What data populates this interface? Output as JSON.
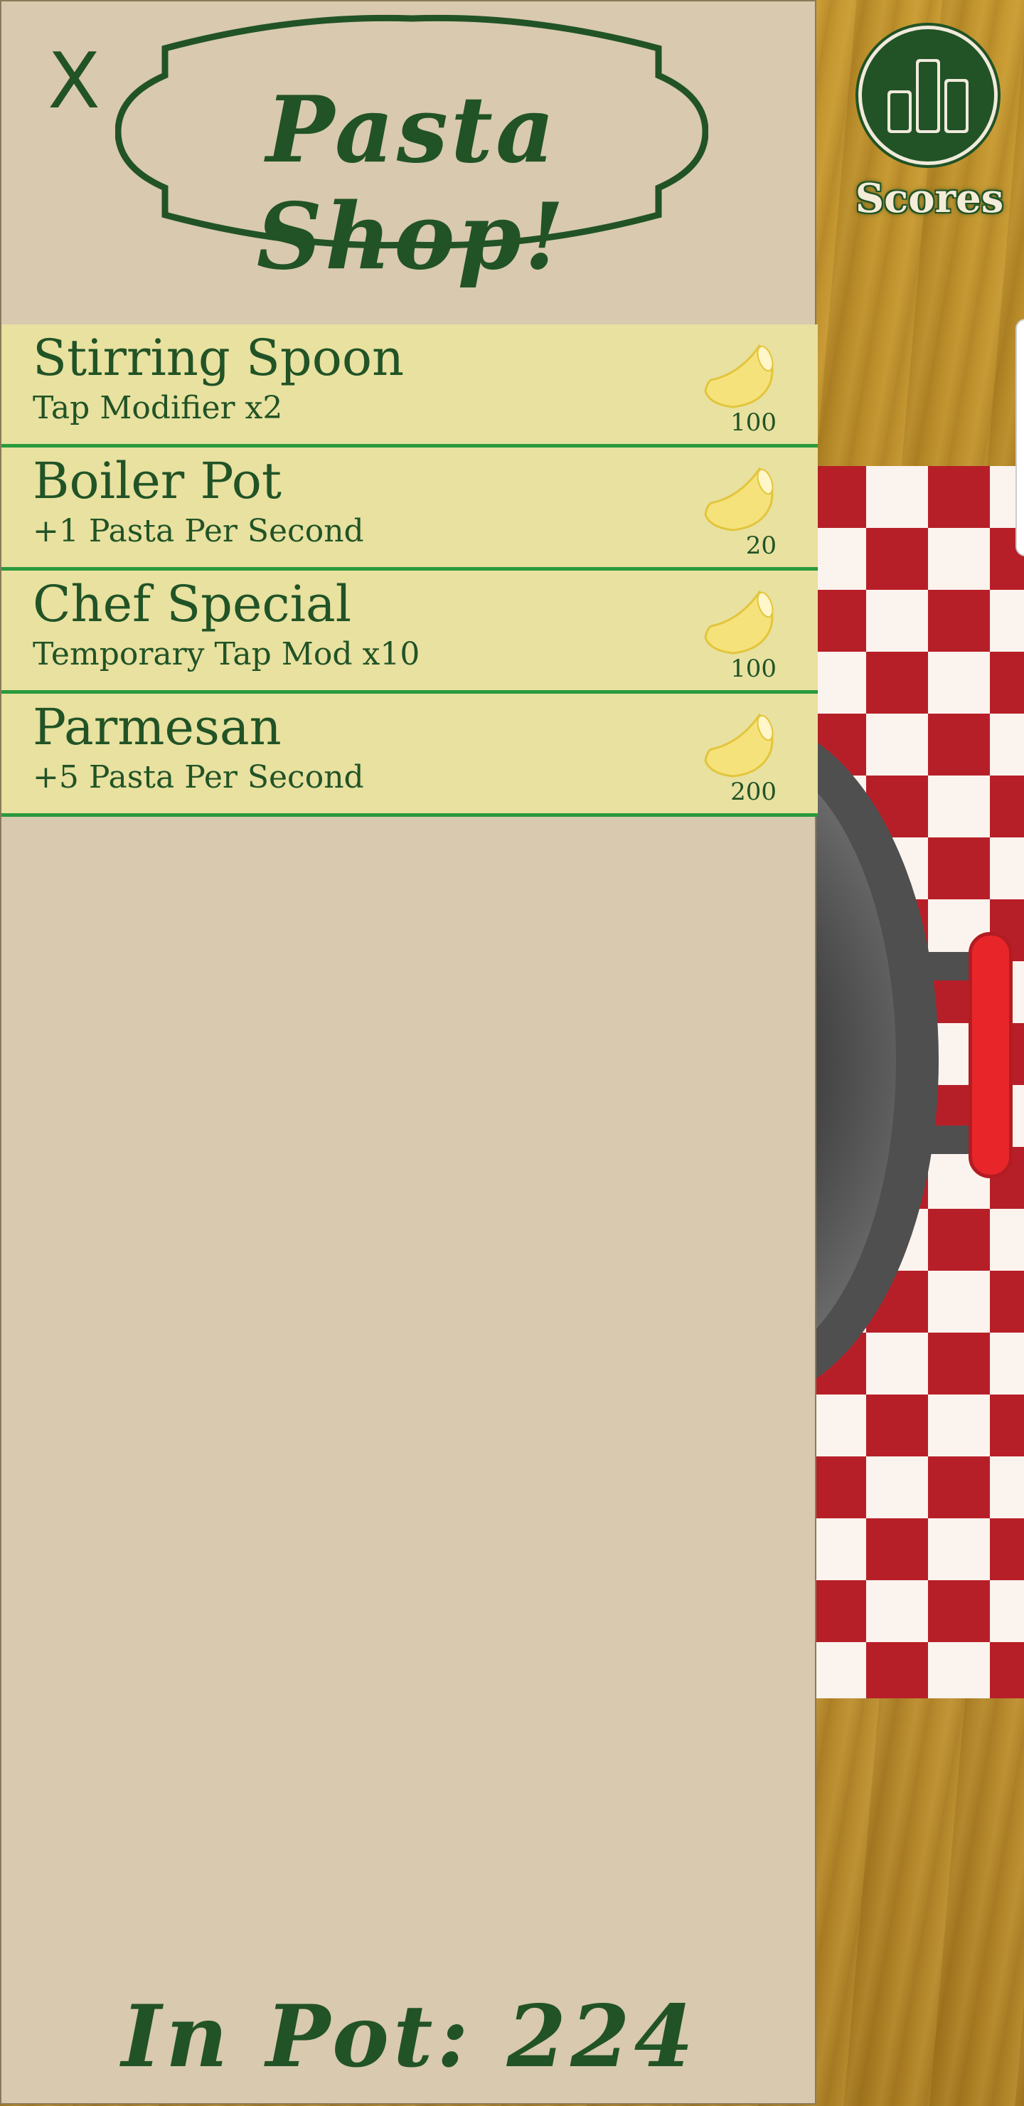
{
  "shop": {
    "close_label": "X",
    "title": "Pasta Shop!",
    "items": [
      {
        "name": "Stirring Spoon",
        "description": "Tap Modifier x2",
        "price": "100",
        "icon": "macaroni-icon"
      },
      {
        "name": "Boiler Pot",
        "description": "+1 Pasta Per Second",
        "price": "20",
        "icon": "macaroni-icon"
      },
      {
        "name": "Chef Special",
        "description": "Temporary Tap Mod x10",
        "price": "100",
        "icon": "macaroni-icon"
      },
      {
        "name": "Parmesan",
        "description": "+5 Pasta Per Second",
        "price": "200",
        "icon": "macaroni-icon"
      }
    ],
    "in_pot_label": "In Pot: 224"
  },
  "scores": {
    "label": "Scores",
    "icon": "bar-chart-icon"
  },
  "colors": {
    "brand_green": "#215326",
    "panel_bg": "#d8c9af",
    "item_bg": "#e8e1a0",
    "item_divider": "#2a9a3c",
    "checker_red": "#b71f28",
    "handle_red": "#e8262a"
  }
}
